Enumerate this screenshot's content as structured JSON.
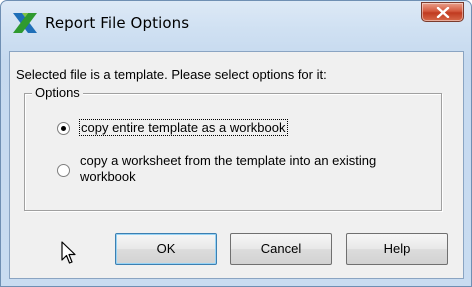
{
  "window": {
    "title": "Report File Options",
    "close_symbol": "x"
  },
  "dialog": {
    "prompt": "Selected file is a template.  Please select options for it:",
    "group_label": "Options",
    "options": [
      {
        "label": "copy entire template as a workbook",
        "selected": true
      },
      {
        "label": "copy a worksheet from the template into an existing workbook",
        "selected": false
      }
    ]
  },
  "buttons": {
    "ok": "OK",
    "cancel": "Cancel",
    "help": "Help"
  },
  "icons": {
    "app": "app-logo-icon",
    "close": "close-icon",
    "cursor": "mouse-pointer-icon"
  },
  "colors": {
    "title_bar": "#cfe0f2",
    "close_button": "#c9462c",
    "dialog_bg": "#f0f0f0",
    "app_icon_green": "#2f9a2f",
    "app_icon_blue": "#1f6fb8"
  }
}
